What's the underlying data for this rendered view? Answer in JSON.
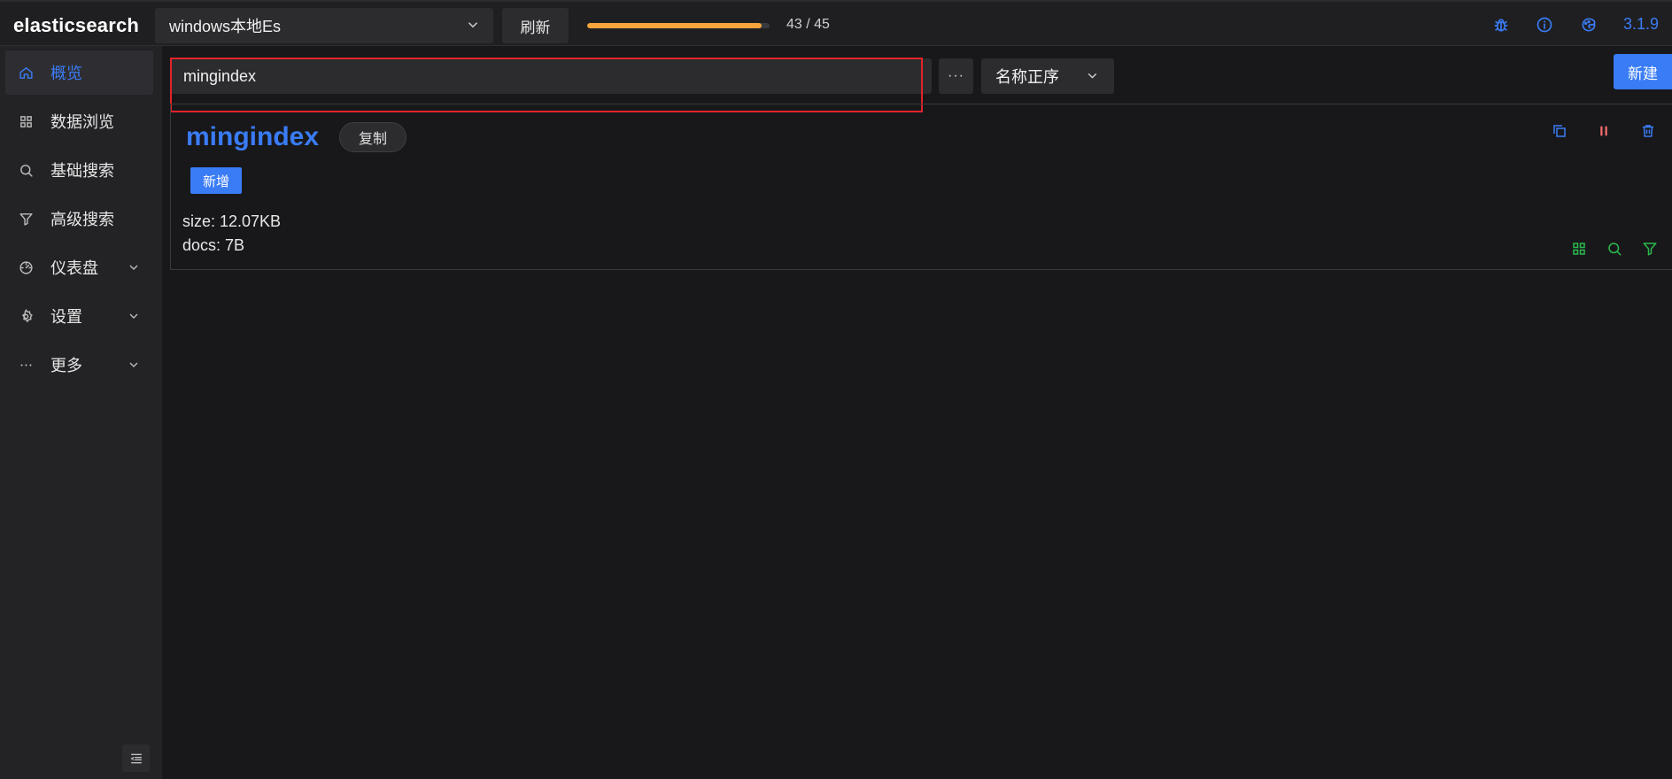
{
  "header": {
    "logo": "elasticsearch",
    "cluster": "windows本地Es",
    "refresh_label": "刷新",
    "progress": {
      "current": 43,
      "total": 45,
      "text": "43 / 45",
      "color": "#f7a53b"
    },
    "icons": [
      "bug-icon",
      "info-icon",
      "theme-icon"
    ],
    "version": "3.1.9"
  },
  "sidebar": {
    "items": [
      {
        "label": "概览",
        "icon": "home-icon",
        "active": true
      },
      {
        "label": "数据浏览",
        "icon": "grid-icon"
      },
      {
        "label": "基础搜索",
        "icon": "search-icon"
      },
      {
        "label": "高级搜索",
        "icon": "filter-icon"
      },
      {
        "label": "仪表盘",
        "icon": "dashboard-icon",
        "expandable": true
      },
      {
        "label": "设置",
        "icon": "settings-icon",
        "expandable": true
      },
      {
        "label": "更多",
        "icon": "ellipsis-icon",
        "expandable": true
      }
    ],
    "collapse_icon": "menu-collapse-icon"
  },
  "toolbar": {
    "search_value": "mingindex",
    "more_label": "···",
    "sort_value": "名称正序",
    "new_label": "新建"
  },
  "index_card": {
    "name": "mingindex",
    "copy_label": "复制",
    "tag": "新增",
    "size": "size: 12.07KB",
    "docs": "docs: 7B",
    "action_icons": [
      "copy-icon",
      "pause-icon",
      "delete-icon"
    ],
    "view_icons": [
      "grid-icon",
      "search-icon",
      "filter-icon"
    ]
  },
  "colors": {
    "accent": "#3a7cf5",
    "danger": "#f56c6c",
    "success": "#2bb94c",
    "highlight": "#e0242a",
    "background": "#18181b"
  }
}
